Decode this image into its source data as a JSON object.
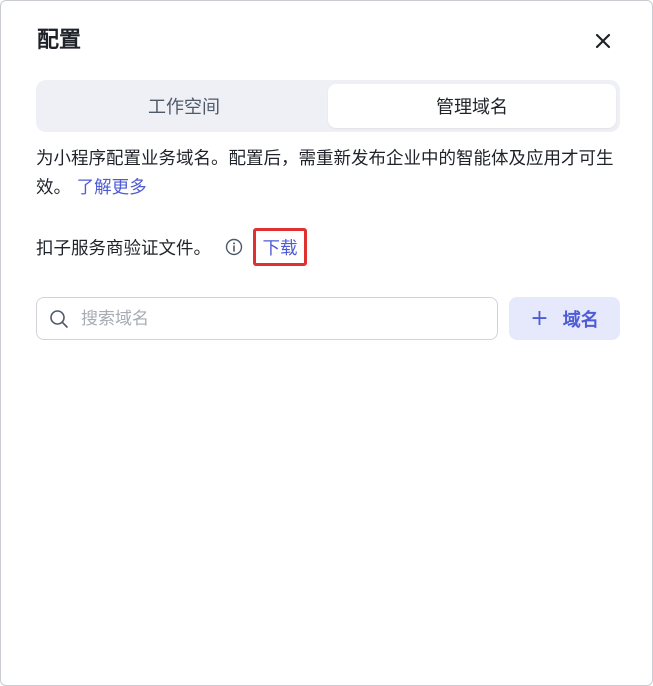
{
  "dialog": {
    "title": "配置"
  },
  "tabs": [
    {
      "label": "工作空间",
      "active": false
    },
    {
      "label": "管理域名",
      "active": true
    }
  ],
  "description": {
    "text": "为小程序配置业务域名。配置后，需重新发布企业中的智能体及应用才可生效。",
    "learn_more": "了解更多"
  },
  "verify": {
    "label": "扣子服务商验证文件。",
    "download": "下载"
  },
  "search": {
    "placeholder": "搜索域名",
    "value": ""
  },
  "add_button": {
    "icon": "+",
    "label": "域名"
  },
  "colors": {
    "accent": "#4e5bd6",
    "highlight_border": "#e03131",
    "tab_bg": "#eef0f6",
    "add_bg": "#e6e8fb"
  }
}
